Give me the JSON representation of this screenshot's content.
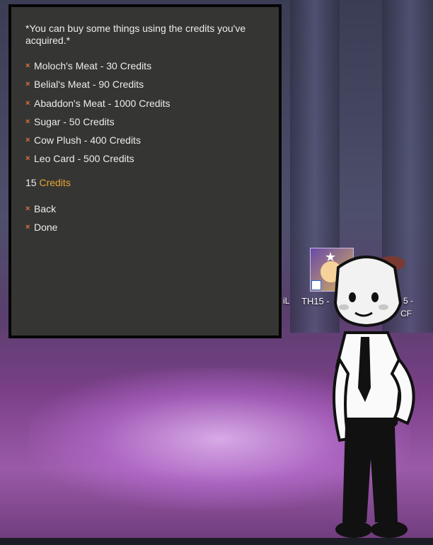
{
  "dialog": {
    "intro": "*You can buy some things using the credits you've acquired.*",
    "items": [
      {
        "label": "Moloch's Meat - 30 Credits"
      },
      {
        "label": "Belial's Meat - 90 Credits"
      },
      {
        "label": "Abaddon's Meat - 1000 Credits"
      },
      {
        "label": "Sugar - 50 Credits"
      },
      {
        "label": "Cow Plush - 400 Credits"
      },
      {
        "label": "Leo Card - 500 Credits"
      }
    ],
    "balance_amount": "15",
    "balance_unit": "Credits",
    "actions": [
      {
        "label": "Back"
      },
      {
        "label": "Done"
      }
    ],
    "bullet": "×"
  },
  "desktop": {
    "icon_label": "TH15 -",
    "icon_tag": "TH",
    "left_fragment": "iL",
    "right_fragment": "5 -",
    "right_fragment2": "CF"
  },
  "colors": {
    "accent": "#e8a532",
    "bullet": "#e0733a",
    "panel": "#353633"
  }
}
